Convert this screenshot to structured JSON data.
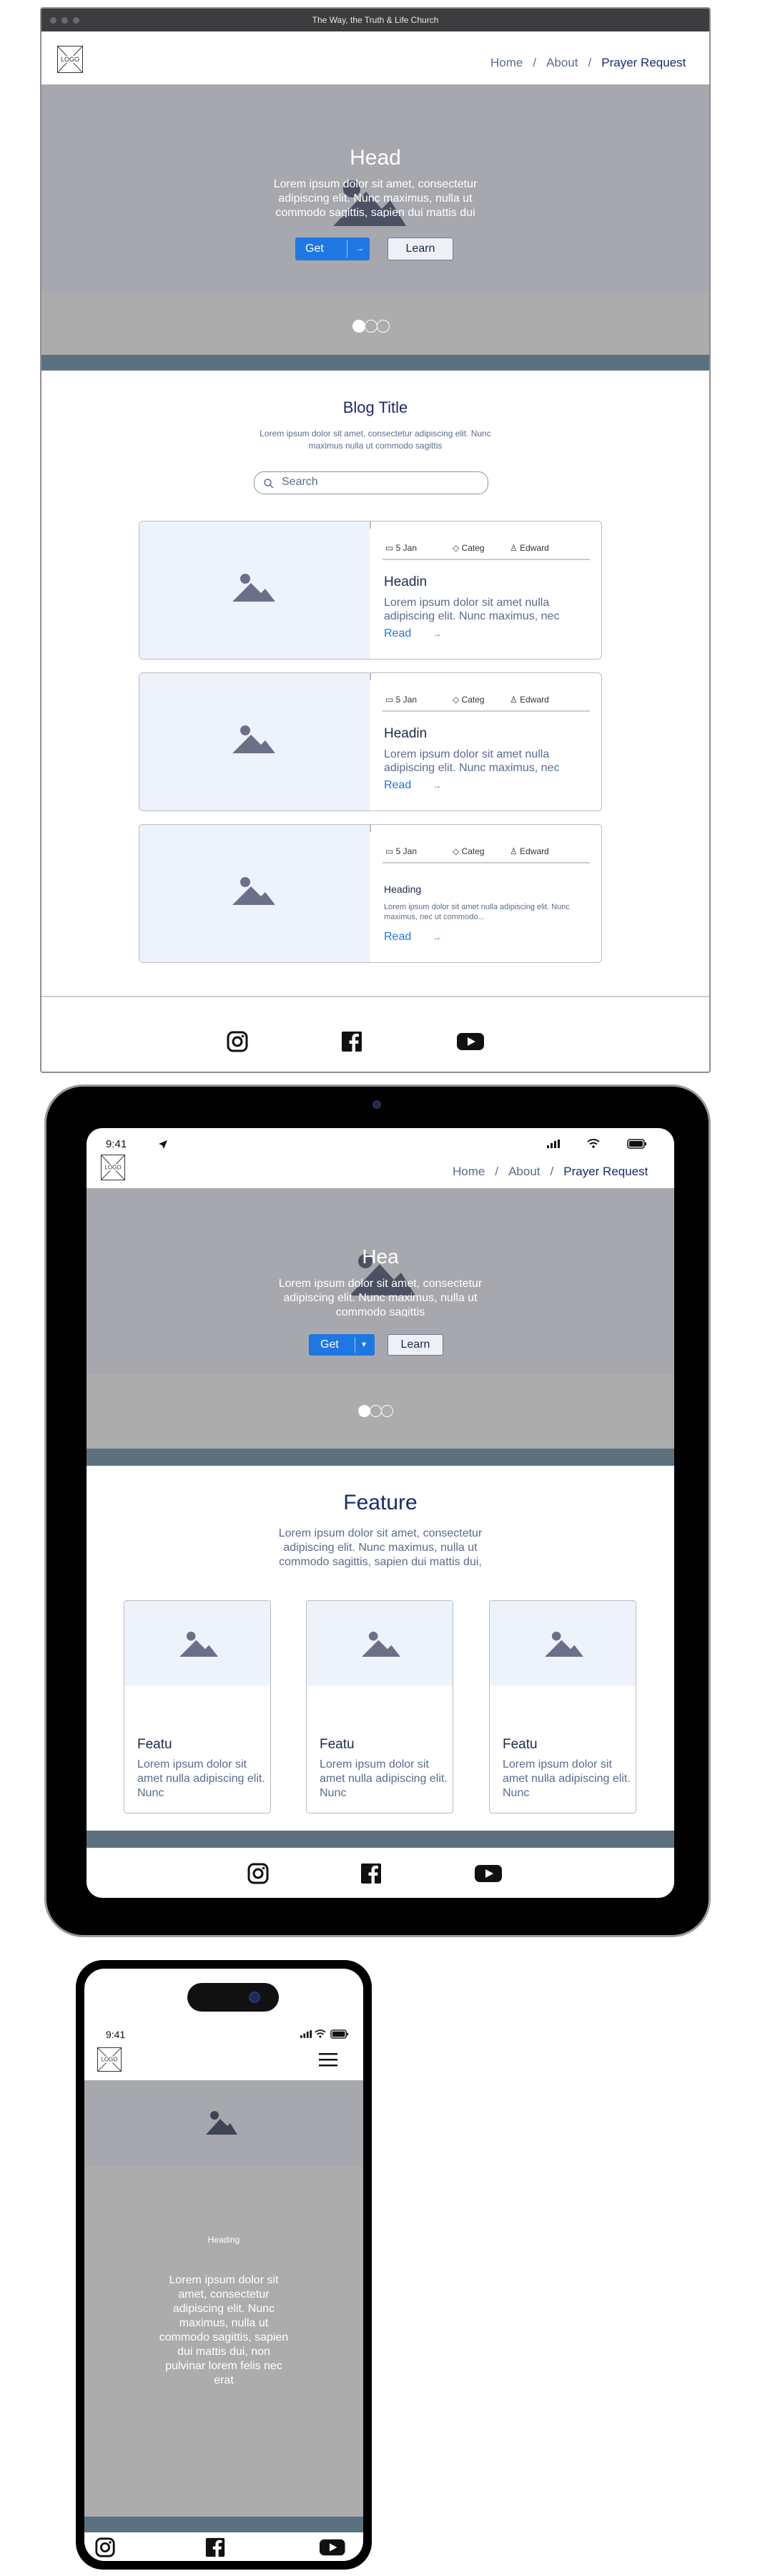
{
  "desktop": {
    "window_title": "The Way, the Truth & Life Church",
    "logo": "LOGO",
    "nav": {
      "home": "Home",
      "about": "About",
      "prayer": "Prayer Request",
      "sep": "/"
    },
    "hero": {
      "heading": "Head",
      "text": "Lorem ipsum dolor sit amet, consectetur adipiscing elit. Nunc maximus, nulla ut commodo sagittis, sapien dui mattis dui",
      "primary_button": "Get",
      "secondary_button": "Learn",
      "carousel": {
        "count": 3,
        "active": 1
      }
    },
    "blog": {
      "title": "Blog Title",
      "subtitle": "Lorem ipsum dolor sit amet, consectetur adipiscing elit. Nunc maximus nulla ut commodo sagittis",
      "search_placeholder": "Search",
      "posts": [
        {
          "date": "5 Jan",
          "category": "Categ",
          "author": "Edward",
          "heading": "Headin",
          "text": "Lorem ipsum dolor sit amet nulla adipiscing elit. Nunc maximus, nec",
          "read": "Read"
        },
        {
          "date": "5 Jan",
          "category": "Categ",
          "author": "Edward",
          "heading": "Headin",
          "text": "Lorem ipsum dolor sit amet nulla adipiscing elit. Nunc maximus, nec",
          "read": "Read"
        },
        {
          "date": "5 Jan",
          "category": "Categ",
          "author": "Edward",
          "heading": "Heading",
          "text": "Lorem ipsum dolor sit amet nulla adipiscing elit. Nunc maximus, nec ut commodo...",
          "read": "Read"
        }
      ]
    },
    "social": [
      "instagram-icon",
      "facebook-icon",
      "youtube-icon"
    ]
  },
  "tablet": {
    "status_time": "9:41",
    "logo": "LOGO",
    "nav": {
      "home": "Home",
      "about": "About",
      "prayer": "Prayer Request",
      "sep": "/"
    },
    "hero": {
      "heading": "Hea",
      "text": "Lorem ipsum dolor sit amet, consectetur adipiscing elit. Nunc maximus, nulla ut commodo sagittis",
      "primary_button": "Get",
      "secondary_button": "Learn",
      "carousel": {
        "count": 3,
        "active": 1
      }
    },
    "feature": {
      "title": "Feature",
      "text": "Lorem ipsum dolor sit amet, consectetur adipiscing elit. Nunc maximus, nulla ut commodo sagittis, sapien dui mattis dui, non",
      "cards": [
        {
          "heading": "Featu",
          "text": "Lorem ipsum dolor sit amet nulla adipiscing elit. Nunc"
        },
        {
          "heading": "Featu",
          "text": "Lorem ipsum dolor sit amet nulla adipiscing elit. Nunc"
        },
        {
          "heading": "Featu",
          "text": "Lorem ipsum dolor sit amet nulla adipiscing elit. Nunc"
        }
      ]
    },
    "social": [
      "instagram-icon",
      "facebook-icon",
      "youtube-icon"
    ]
  },
  "phone": {
    "status_time": "9:41",
    "logo": "LOGO",
    "hero": {
      "heading": "Heading",
      "text": "Lorem ipsum dolor sit amet, consectetur adipiscing elit. Nunc maximus, nulla ut commodo sagittis, sapien dui mattis dui, non pulvinar lorem felis nec erat"
    },
    "social": [
      "instagram-icon",
      "facebook-icon",
      "youtube-icon"
    ]
  },
  "colors": {
    "accent": "#1e77e3",
    "hero_gray": "#a7a8ad",
    "band_gray": "#acacac",
    "slate": "#5b7180",
    "navy_text": "#1b2a6b",
    "image_placeholder": "#eef3fb"
  }
}
